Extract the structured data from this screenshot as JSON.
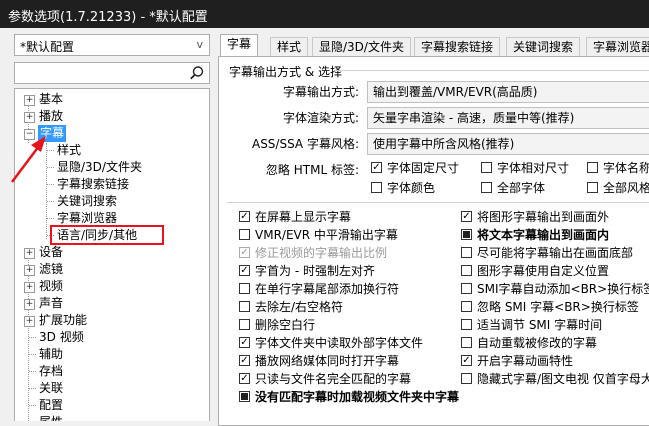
{
  "window": {
    "title": "参数选项(1.7.21233) - *默认配置"
  },
  "left": {
    "profile": {
      "value": "*默认配置",
      "chevron": "v"
    },
    "search": {
      "icon": "search-icon"
    },
    "tree": [
      {
        "label": "基本"
      },
      {
        "label": "播放"
      },
      {
        "label": "字幕"
      },
      {
        "label": "样式"
      },
      {
        "label": "显隐/3D/文件夹"
      },
      {
        "label": "字幕搜索链接"
      },
      {
        "label": "关键词搜索"
      },
      {
        "label": "字幕浏览器"
      },
      {
        "label": "语言/同步/其他"
      },
      {
        "label": "设备"
      },
      {
        "label": "滤镜"
      },
      {
        "label": "视频"
      },
      {
        "label": "声音"
      },
      {
        "label": "扩展功能"
      },
      {
        "label": "3D 视频"
      },
      {
        "label": "辅助"
      },
      {
        "label": "存档"
      },
      {
        "label": "关联"
      },
      {
        "label": "配置"
      },
      {
        "label": "属性"
      }
    ]
  },
  "tabs": [
    "字幕",
    "样式",
    "显隐/3D/文件夹",
    "字幕搜索链接",
    "关键词搜索",
    "字幕浏览器"
  ],
  "panel": {
    "group_title": "字幕输出方式 & 选择",
    "rows": [
      {
        "label": "字幕输出方式:",
        "value": "输出到覆盖/VMR/EVR(高品质)"
      },
      {
        "label": "字体渲染方式:",
        "value": "矢量字串渲染 - 高速，质量中等(推荐)"
      },
      {
        "label": "ASS/SSA 字幕风格:",
        "value": "使用字幕中所含风格(推荐)"
      }
    ],
    "html_label": "忽略 HTML 标签:",
    "html_tags": [
      {
        "label": "字体固定尺寸",
        "mark": "✓"
      },
      {
        "label": "字体相对尺寸",
        "mark": ""
      },
      {
        "label": "字体名称",
        "mark": ""
      },
      {
        "label": "字体颜色",
        "mark": ""
      },
      {
        "label": "全部字体",
        "mark": ""
      },
      {
        "label": "全部风格",
        "mark": ""
      }
    ],
    "left_options": [
      {
        "label": "在屏幕上显示字幕",
        "mark": "✓"
      },
      {
        "label": "VMR/EVR 中平滑输出字幕",
        "mark": ""
      },
      {
        "label": "修正视频的字幕输出比例",
        "mark": "✓"
      },
      {
        "label": "字首为 - 时强制左对齐",
        "mark": "✓"
      },
      {
        "label": "在单行字幕尾部添加换行符",
        "mark": ""
      },
      {
        "label": "去除左/右空格符",
        "mark": ""
      },
      {
        "label": "删除空白行",
        "mark": ""
      },
      {
        "label": "字体文件夹中读取外部字体文件",
        "mark": "✓"
      },
      {
        "label": "播放网络媒体同时打开字幕",
        "mark": "✓"
      },
      {
        "label": "只读与文件名完全匹配的字幕",
        "mark": "✓"
      },
      {
        "label": "没有匹配字幕时加载视频文件夹中字幕",
        "mark": ""
      }
    ],
    "right_options": [
      {
        "label": "将图形字幕输出到画面外",
        "mark": "✓"
      },
      {
        "label": "将文本字幕输出到画面内",
        "mark": ""
      },
      {
        "label": "尽可能将字幕输出在画面底部",
        "mark": ""
      },
      {
        "label": "图形字幕使用自定义位置",
        "mark": ""
      },
      {
        "label": "SMI字幕自动添加<BR>换行标签",
        "mark": ""
      },
      {
        "label": "忽略 SMI 字幕<BR>换行标签",
        "mark": ""
      },
      {
        "label": "适当调节 SMI 字幕时间",
        "mark": ""
      },
      {
        "label": "自动重载被修改的字幕",
        "mark": ""
      },
      {
        "label": "开启字幕动画特性",
        "mark": "✓"
      },
      {
        "label": "隐藏式字幕/图文电视 仅首字母大写",
        "mark": ""
      }
    ]
  },
  "colors": {
    "accent": "#3399ff",
    "annotation": "#e8141a",
    "titlebar": "#1f1f1f"
  }
}
